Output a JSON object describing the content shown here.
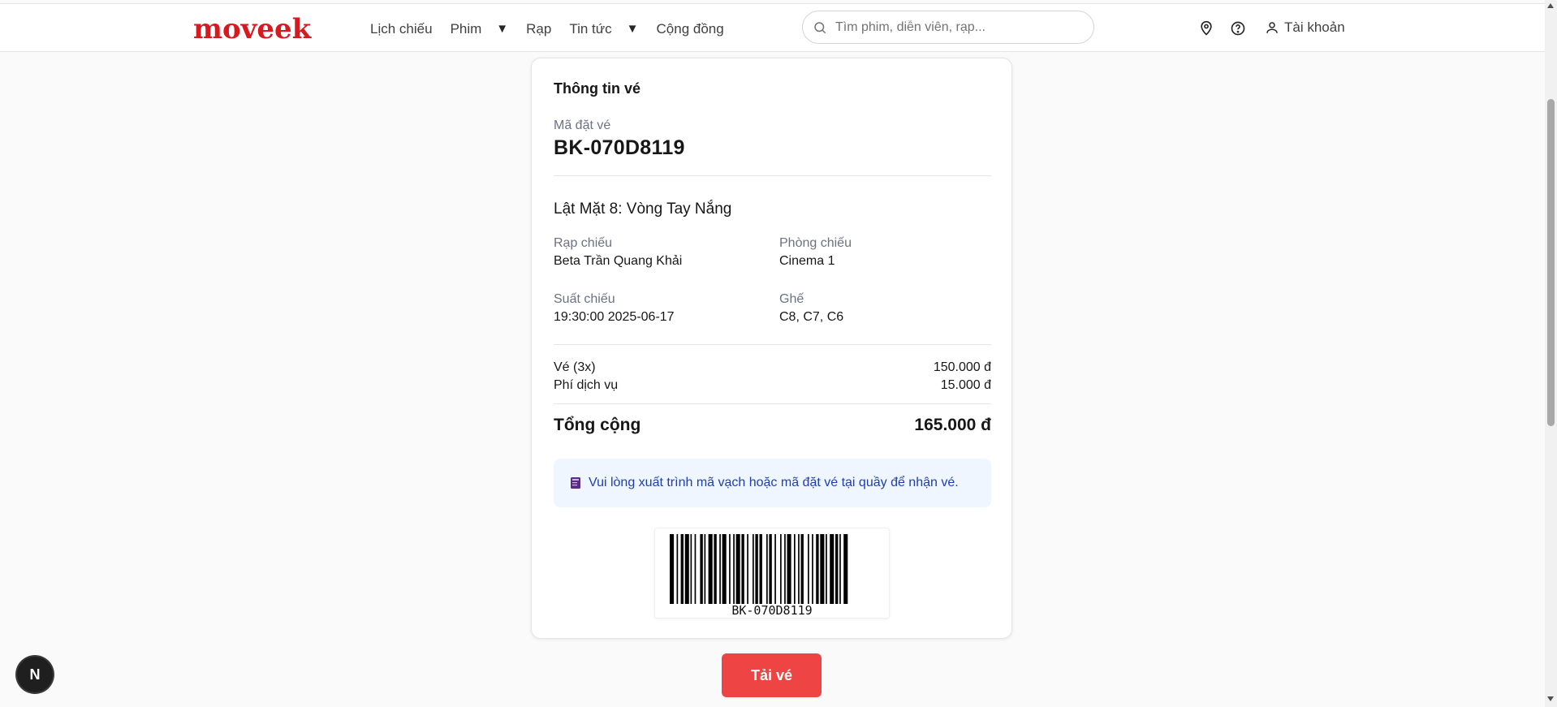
{
  "header": {
    "logo": "moveek",
    "nav": [
      {
        "label": "Lịch chiếu",
        "dropdown": false
      },
      {
        "label": "Phim",
        "dropdown": true
      },
      {
        "label": "Rạp",
        "dropdown": false
      },
      {
        "label": "Tin tức",
        "dropdown": true
      },
      {
        "label": "Cộng đồng",
        "dropdown": false
      }
    ],
    "search_placeholder": "Tìm phim, diễn viên, rạp...",
    "account_label": "Tài khoản"
  },
  "ticket": {
    "title": "Thông tin vé",
    "code_label": "Mã đặt vé",
    "code_value": "BK-070D8119",
    "movie_title": "Lật Mặt 8: Vòng Tay Nắng",
    "details": {
      "cinema_label": "Rạp chiếu",
      "cinema_value": "Beta Trần Quang Khải",
      "room_label": "Phòng chiếu",
      "room_value": "Cinema 1",
      "showtime_label": "Suất chiếu",
      "showtime_value": "19:30:00 2025-06-17",
      "seat_label": "Ghế",
      "seat_value": "C8, C7, C6"
    },
    "prices": {
      "ticket_label": "Vé (3x)",
      "ticket_value": "150.000 đ",
      "fee_label": "Phí dịch vụ",
      "fee_value": "15.000 đ",
      "total_label": "Tổng cộng",
      "total_value": "165.000 đ"
    },
    "notice": "Vui lòng xuất trình mã vạch hoặc mã đặt vé tại quầy để nhận vé.",
    "barcode_text": "BK-070D8119"
  },
  "download_label": "Tải vé",
  "next_badge": "N",
  "colors": {
    "brand": "#d71920",
    "button": "#ef4444",
    "notice_bg": "#eff6ff",
    "notice_text": "#1e40af"
  },
  "icons": [
    "search-icon",
    "location-pin-icon",
    "help-circle-icon",
    "user-icon",
    "book-icon",
    "caret-down-icon"
  ]
}
